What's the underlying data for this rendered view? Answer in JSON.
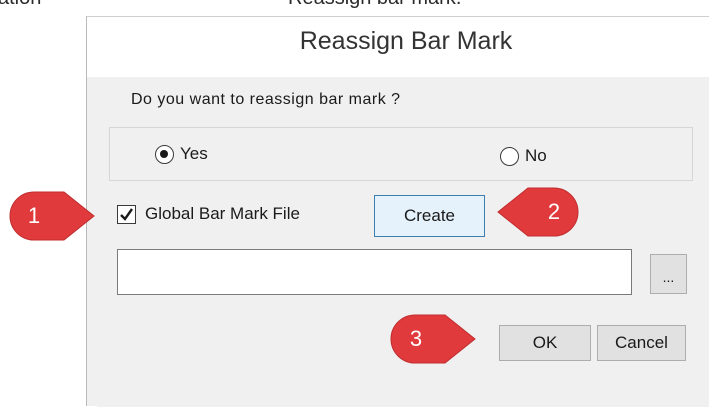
{
  "caption": {
    "left": "ation",
    "right": "Reassign bar mark."
  },
  "dialog": {
    "title": "Reassign Bar Mark",
    "question": "Do you want to reassign bar mark ?",
    "radio_yes": "Yes",
    "radio_no": "No",
    "selected": "Yes",
    "checkbox_label": "Global Bar Mark File",
    "checkbox_checked": true,
    "create_label": "Create",
    "file_path_value": "",
    "browse_label": "...",
    "ok_label": "OK",
    "cancel_label": "Cancel"
  },
  "callouts": [
    "1",
    "2",
    "3"
  ],
  "colors": {
    "callout": "#e03a3c",
    "focus_border": "#3c7fb1",
    "dialog_bg": "#f0f0f0"
  }
}
